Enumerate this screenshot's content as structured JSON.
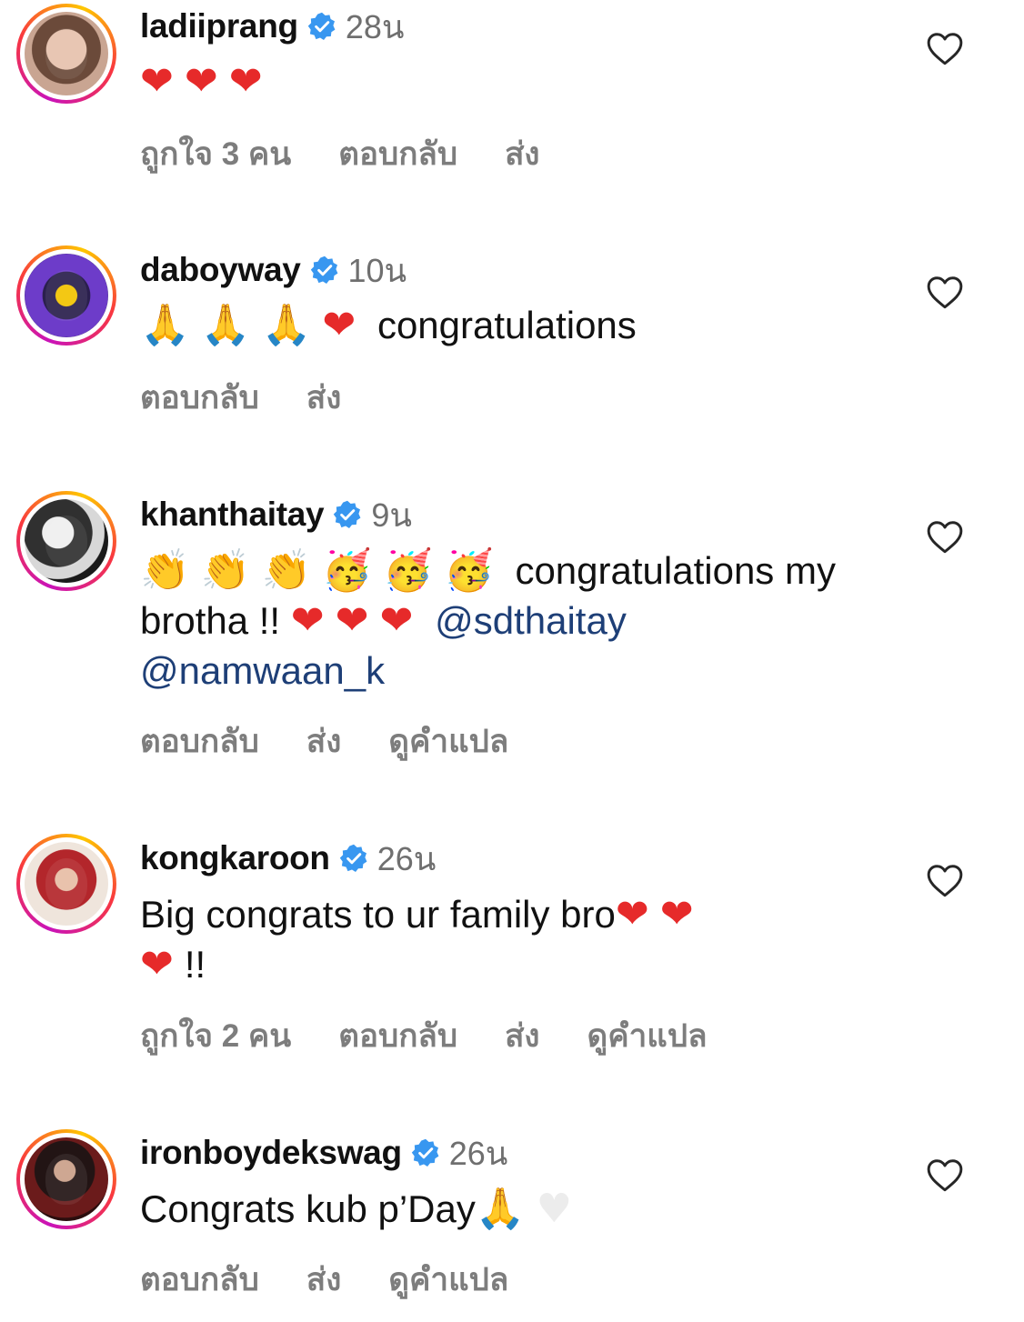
{
  "comments": [
    {
      "username": "ladiiprang",
      "time": "28น",
      "emojis": [
        "❤",
        "❤",
        "❤"
      ],
      "text": "",
      "actions": [
        "ถูกใจ 3 คน",
        "ตอบกลับ",
        "ส่ง"
      ]
    },
    {
      "username": "daboyway",
      "time": "10น",
      "emojis": [
        "🙏",
        "🙏",
        "🙏",
        "❤"
      ],
      "text": "congratulations",
      "actions": [
        "ตอบกลับ",
        "ส่ง"
      ]
    },
    {
      "username": "khanthaitay",
      "time": "9น",
      "emojis": [
        "👏",
        "👏",
        "👏",
        "🥳",
        "🥳",
        "🥳"
      ],
      "text": "congratulations my",
      "text2": "brotha !!",
      "emojis2": [
        "❤",
        "❤",
        "❤"
      ],
      "mention1": "@sdthaitay",
      "mention2": "@namwaan_k",
      "actions": [
        "ตอบกลับ",
        "ส่ง",
        "ดูคำแปล"
      ]
    },
    {
      "username": "kongkaroon",
      "time": "26น",
      "text": "Big congrats to ur family bro",
      "emojis": [
        "❤",
        "❤"
      ],
      "emojis2": [
        "❤"
      ],
      "text2": "!!",
      "actions": [
        "ถูกใจ 2 คน",
        "ตอบกลับ",
        "ส่ง",
        "ดูคำแปล"
      ]
    },
    {
      "username": "ironboydekswag",
      "time": "26น",
      "text": "Congrats kub p’Day",
      "emojis": [
        "🙏",
        "♥"
      ],
      "actions": [
        "ตอบกลับ",
        "ส่ง",
        "ดูคำแปล"
      ]
    }
  ],
  "icons": {
    "verified_color": "#3897f0",
    "like": "heart-outline-icon"
  }
}
